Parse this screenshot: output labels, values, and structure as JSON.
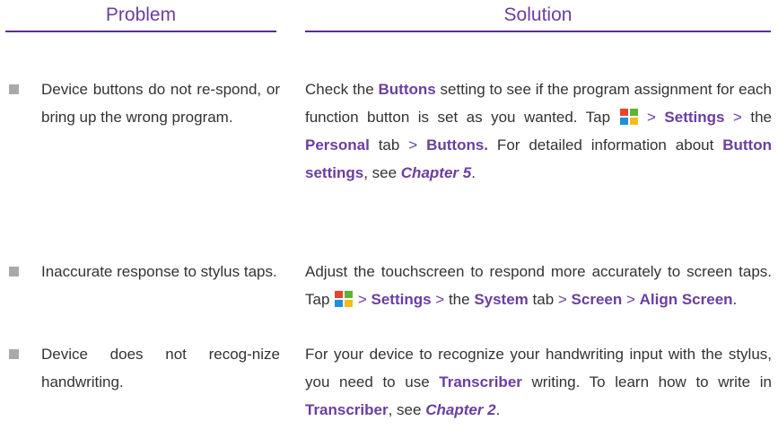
{
  "headers": {
    "problem": "Problem",
    "solution": "Solution"
  },
  "rows": [
    {
      "problem": "Device buttons do not re-spond, or bring up the wrong program.",
      "solution": {
        "t1": "Check the ",
        "b1": "Buttons",
        "t2": " setting to see if the program assignment for each function button is set as you wanted. Tap ",
        "gt1": " > ",
        "b2": "Settings",
        "gt2": " > ",
        "t3": "the ",
        "b3": "Personal",
        "t4": " tab ",
        "gt3": "> ",
        "b4": " Buttons.",
        "t5": " For detailed information about ",
        "b5": "Button settings",
        "t6": ", see ",
        "bi1": "Chapter 5",
        "t7": "."
      }
    },
    {
      "problem": "Inaccurate response to stylus taps.",
      "solution": {
        "t1": "Adjust the touchscreen to respond more accurately to screen taps. Tap ",
        "gt1": " > ",
        "b1": "Settings",
        "gt2": " > ",
        "t2": "the ",
        "b2": "System",
        "t3": " tab ",
        "gt3": "> ",
        "b3": "Screen",
        "gt4": " > ",
        "b4": "Align Screen",
        "t4": "."
      }
    },
    {
      "problem": "Device does not recog-nize handwriting.",
      "solution": {
        "t1": "For your device to recognize your handwriting input with the stylus, you need to use ",
        "b1": "Transcriber",
        "t2": " writing. To learn how to write in ",
        "b2": "Transcriber",
        "t3": ", see ",
        "bi1": "Chapter 2",
        "t4": "."
      }
    }
  ],
  "icons": {
    "start": "windows-start-icon"
  },
  "colors": {
    "accent": "#6a3ea1",
    "rule": "#5a2d91",
    "text": "#333333",
    "bullet": "#a9a9a9"
  }
}
